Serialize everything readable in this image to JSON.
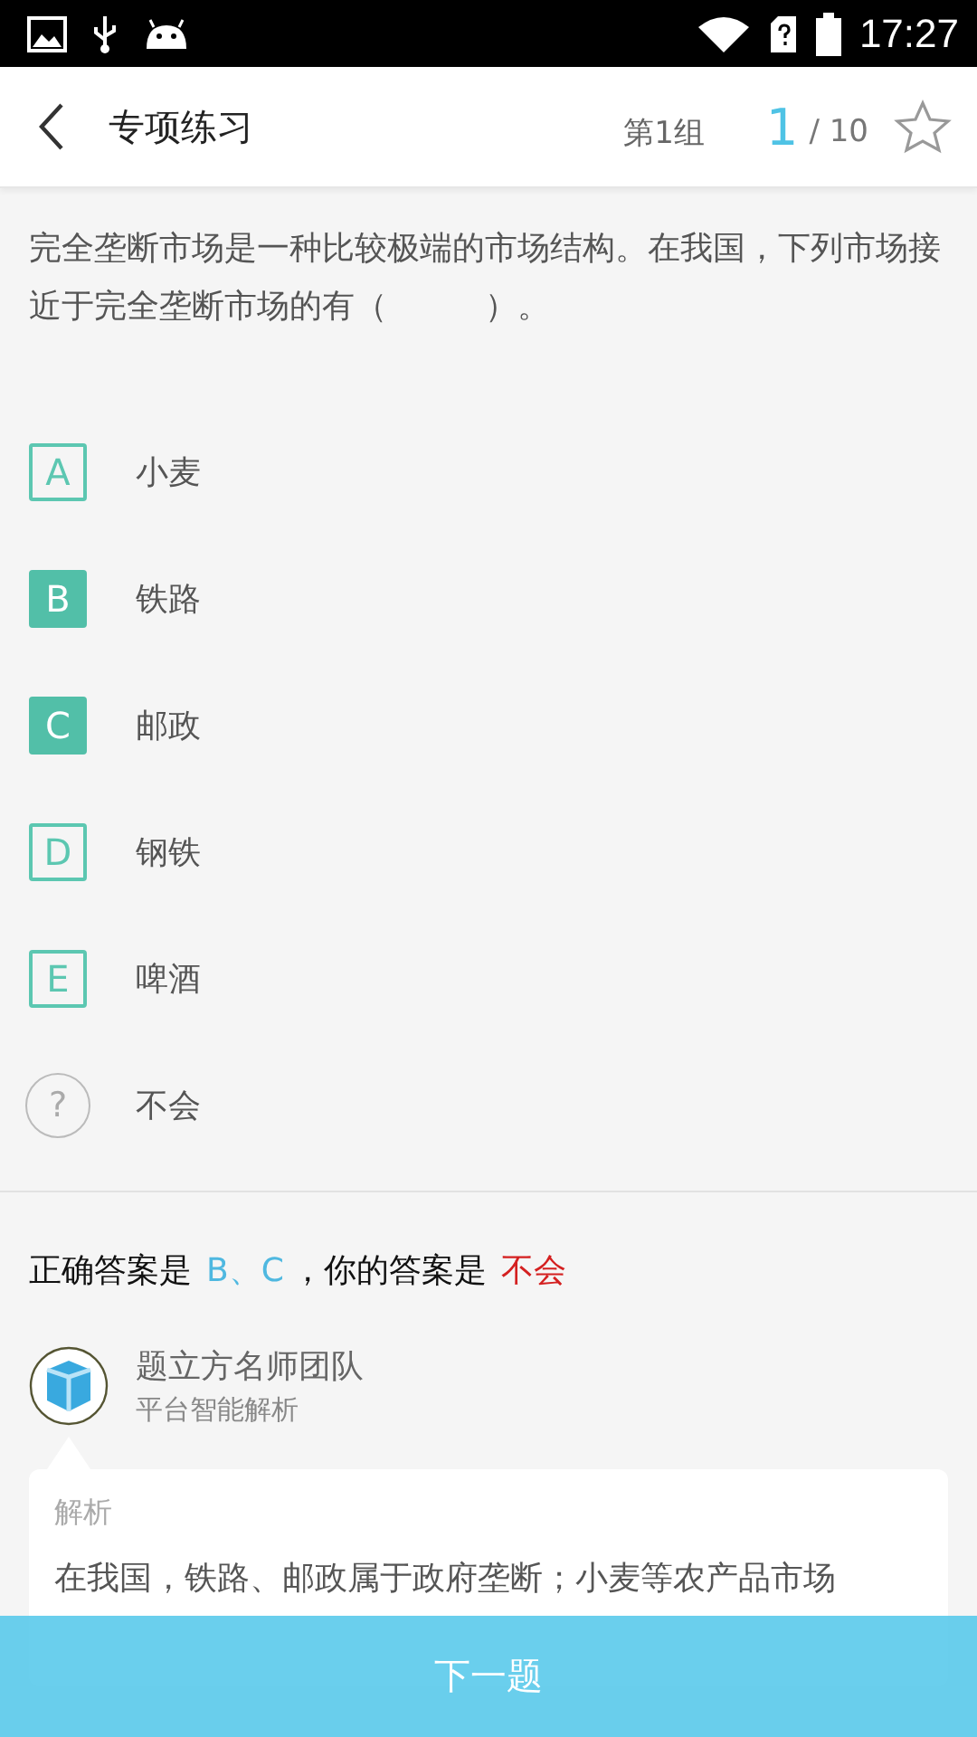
{
  "status_bar": {
    "time": "17:27"
  },
  "header": {
    "title": "专项练习",
    "group": "第1组",
    "current": "1",
    "total": "/ 10",
    "starred": false
  },
  "question": "完全垄断市场是一种比较极端的市场结构。在我国，下列市场接近于完全垄断市场的有（　　　）。",
  "options": [
    {
      "kind": "letter",
      "mark": "A",
      "label": "小麦",
      "correct": false
    },
    {
      "kind": "letter",
      "mark": "B",
      "label": "铁路",
      "correct": true
    },
    {
      "kind": "letter",
      "mark": "C",
      "label": "邮政",
      "correct": true
    },
    {
      "kind": "letter",
      "mark": "D",
      "label": "钢铁",
      "correct": false
    },
    {
      "kind": "letter",
      "mark": "E",
      "label": "啤酒",
      "correct": false
    },
    {
      "kind": "unknown",
      "mark": "?",
      "label": "不会",
      "correct": false
    }
  ],
  "result": {
    "correct_label": "正确答案是",
    "correct_value": "B、C",
    "your_label": "，你的答案是",
    "your_value": "不会"
  },
  "analyst": {
    "name": "题立方名师团队",
    "subtitle": "平台智能解析"
  },
  "analysis": {
    "title": "解析",
    "lines": [
      "在我国，铁路、邮政属于政府垄断；小麦等农产品市场"
    ]
  },
  "next_button": "下一题"
}
